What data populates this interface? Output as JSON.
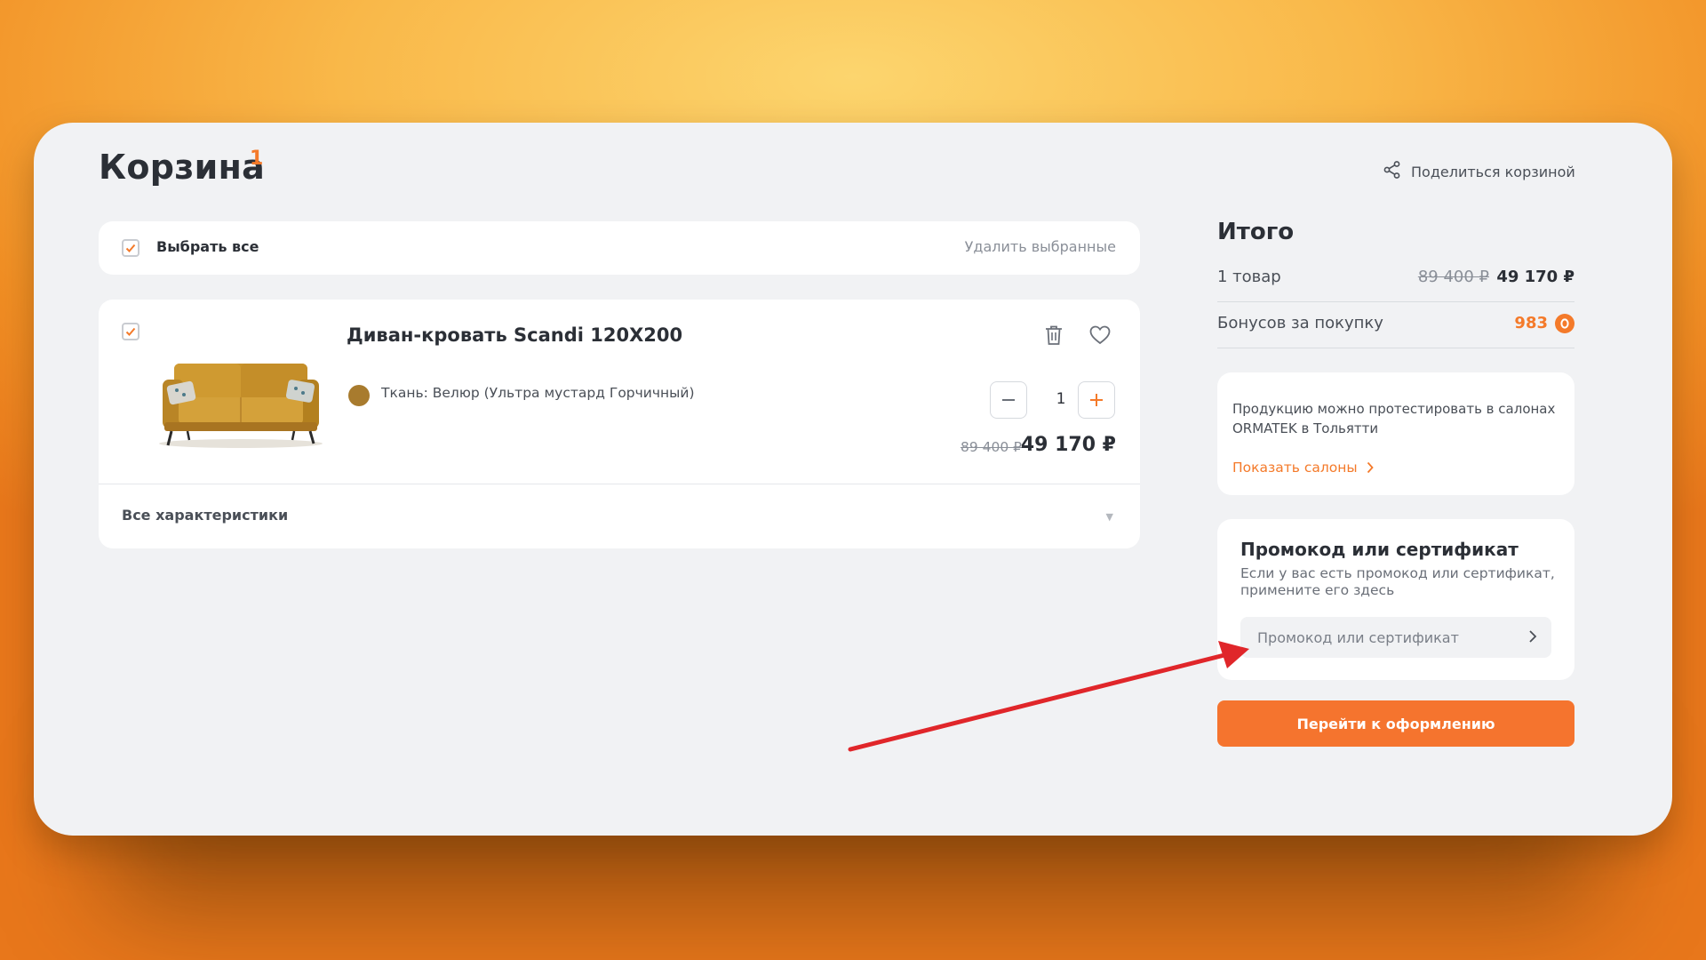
{
  "page": {
    "title": "Корзина",
    "title_count": "1",
    "share_label": "Поделиться корзиной"
  },
  "select_bar": {
    "select_all_label": "Выбрать все",
    "delete_selected_label": "Удалить выбранные"
  },
  "cart_item": {
    "name": "Диван-кровать Scandi 120Х200",
    "fabric": "Ткань: Велюр (Ультра мустард Горчичный)",
    "fabric_color": "#a87b2e",
    "quantity": "1",
    "old_price": "89 400 ₽",
    "price": "49 170 ₽",
    "all_specs_label": "Все характеристики",
    "checked": true
  },
  "summary": {
    "title": "Итого",
    "items_label": "1 товар",
    "items_old_price": "89 400 ₽",
    "items_price": "49 170 ₽",
    "bonus_label": "Бонусов за покупку",
    "bonus_value": "983"
  },
  "salons": {
    "text": "Продукцию можно протестировать в салонах ORMATEK в Тольятти",
    "link_label": "Показать салоны"
  },
  "promo": {
    "title": "Промокод или сертификат",
    "description": "Если у вас есть промокод или сертификат, примените его здесь",
    "input_placeholder": "Промокод или сертификат"
  },
  "checkout": {
    "button_label": "Перейти к оформлению"
  },
  "colors": {
    "accent": "#f47a2a",
    "checkout_button": "#f5742e",
    "annotation_arrow": "#e0262a"
  }
}
